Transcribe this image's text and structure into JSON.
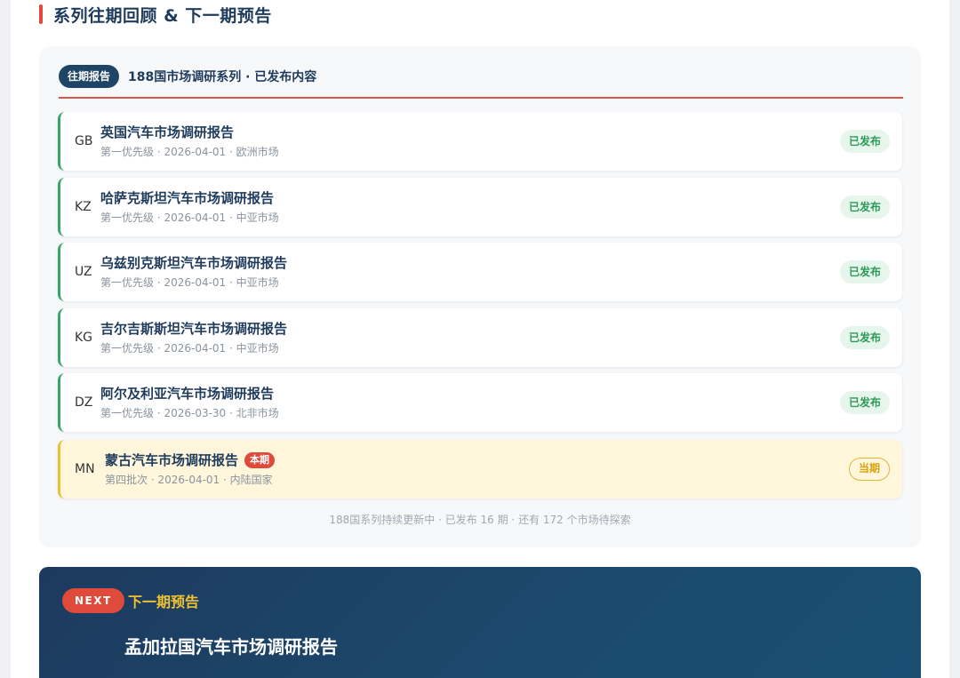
{
  "section": {
    "title": "系列往期回顾 & 下一期预告"
  },
  "archive": {
    "badge": "往期报告",
    "heading": "188国市场调研系列 · 已发布内容",
    "items": [
      {
        "code": "GB",
        "title": "英国汽车市场调研报告",
        "meta": "第一优先级 · 2026-04-01 · 欧洲市场",
        "status": "已发布"
      },
      {
        "code": "KZ",
        "title": "哈萨克斯坦汽车市场调研报告",
        "meta": "第一优先级 · 2026-04-01 · 中亚市场",
        "status": "已发布"
      },
      {
        "code": "UZ",
        "title": "乌兹别克斯坦汽车市场调研报告",
        "meta": "第一优先级 · 2026-04-01 · 中亚市场",
        "status": "已发布"
      },
      {
        "code": "KG",
        "title": "吉尔吉斯斯坦汽车市场调研报告",
        "meta": "第一优先级 · 2026-04-01 · 中亚市场",
        "status": "已发布"
      },
      {
        "code": "DZ",
        "title": "阿尔及利亚汽车市场调研报告",
        "meta": "第一优先级 · 2026-03-30 · 北非市场",
        "status": "已发布"
      }
    ],
    "current": {
      "code": "MN",
      "title": "蒙古汽车市场调研报告",
      "tag": "本期",
      "meta": "第四批次 · 2026-04-01 · 内陆国家",
      "status": "当期"
    },
    "footer": "188国系列持续更新中 · 已发布 16 期 · 还有 172 个市场待探索"
  },
  "next": {
    "pill": "NEXT",
    "label": "下一期预告",
    "title": "孟加拉国汽车市场调研报告"
  },
  "colors": {
    "accent_red": "#e04a3a",
    "navy": "#1f3b5c",
    "published_green": "#2e9a58",
    "current_gold": "#d9a312"
  }
}
